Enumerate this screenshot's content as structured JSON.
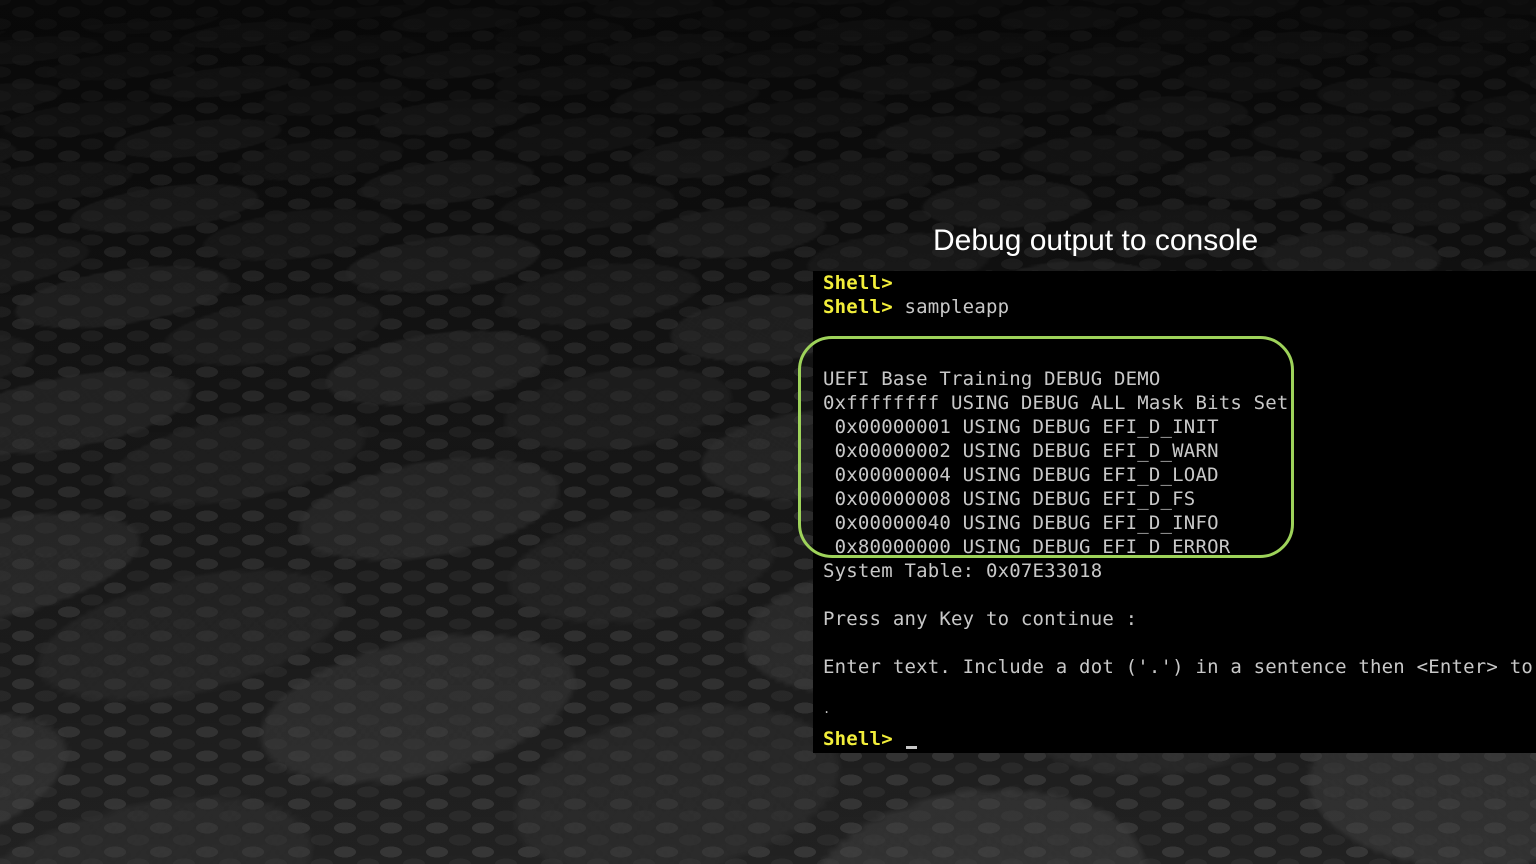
{
  "caption": "Debug output to console",
  "console": {
    "prompt": "Shell>",
    "command": "sampleapp",
    "debug_lines": [
      "UEFI Base Training DEBUG DEMO",
      "0xffffffff USING DEBUG ALL Mask Bits Set",
      " 0x00000001 USING DEBUG EFI_D_INIT",
      " 0x00000002 USING DEBUG EFI_D_WARN",
      " 0x00000004 USING DEBUG EFI_D_LOAD",
      " 0x00000008 USING DEBUG EFI_D_FS",
      " 0x00000040 USING DEBUG EFI_D_INFO",
      " 0x80000000 USING DEBUG EFI_D_ERROR"
    ],
    "system_table": "System Table: 0x07E33018",
    "press_key": "Press any Key to continue :",
    "enter_text": "Enter text. Include a dot ('.') in a sentence then <Enter> to ex",
    "dot_line": "."
  },
  "colors": {
    "prompt": "#f2ee3a",
    "console_text": "#c8c8c8",
    "highlight_border": "#9ed35a"
  }
}
